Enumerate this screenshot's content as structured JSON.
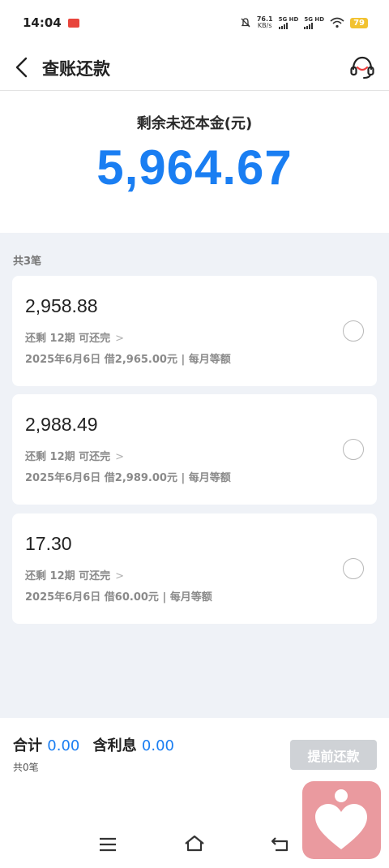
{
  "status_bar": {
    "time": "14:04",
    "net_speed_value": "76.1",
    "net_speed_unit": "KB/s",
    "sim1": "5G HD",
    "sim2": "5G HD",
    "battery": "79"
  },
  "header": {
    "title": "查账还款",
    "back_icon": "chevron-left-icon",
    "service_icon": "headset-icon"
  },
  "summary": {
    "label": "剩余未还本金(元)",
    "amount": "5,964.67"
  },
  "list": {
    "count_label": "共3笔",
    "loans": [
      {
        "amount": "2,958.88",
        "remaining": "还剩 12期 可还完",
        "info": "2025年6月6日 借2,965.00元 | 每月等额"
      },
      {
        "amount": "2,988.49",
        "remaining": "还剩 12期 可还完",
        "info": "2025年6月6日 借2,989.00元 | 每月等额"
      },
      {
        "amount": "17.30",
        "remaining": "还剩 12期 可还完",
        "info": "2025年6月6日 借60.00元 | 每月等额"
      }
    ]
  },
  "footer": {
    "total_label": "合计",
    "total_value": "0.00",
    "interest_label": "含利息",
    "interest_value": "0.00",
    "count": "共0笔",
    "prepay_button": "提前还款"
  },
  "colors": {
    "accent": "#1a7ef2",
    "list_background": "#eff2f7",
    "disabled_button": "#cfd2d6",
    "widget": "#ea9a9f"
  }
}
